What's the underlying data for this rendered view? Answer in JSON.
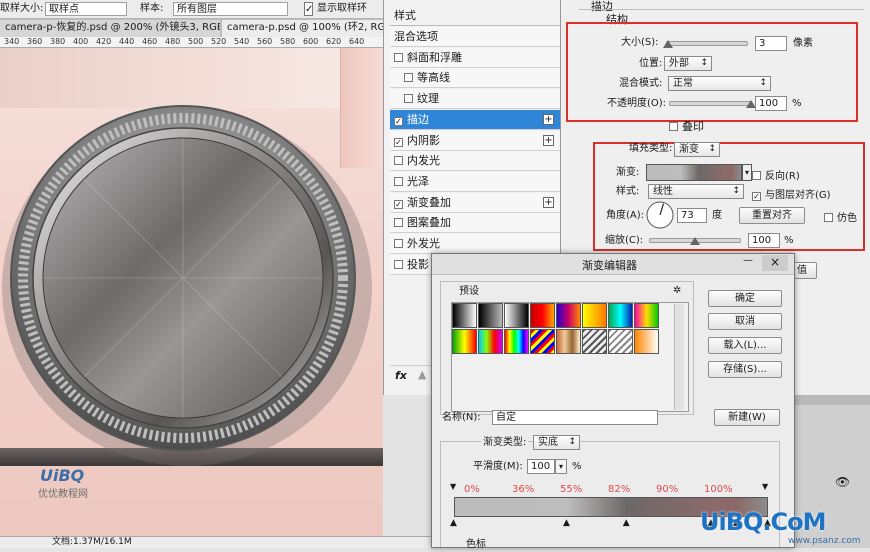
{
  "options_bar": {
    "sample_size_label": "取样大小:",
    "sample_size_value": "取样点",
    "sample_label": "样本:",
    "sample_value": "所有图层",
    "show_ring_label": "显示取样环"
  },
  "doc_tabs": [
    {
      "label": "camera-p-恢复的.psd @ 200% (外镜头3, RGB/8) *",
      "close": "×"
    },
    {
      "label": "camera-p.psd @ 100% (环2, RGB/8)",
      "close": "×"
    }
  ],
  "ruler_ticks": [
    "340",
    "360",
    "380",
    "400",
    "420",
    "440",
    "460",
    "480",
    "500",
    "520",
    "540",
    "560",
    "580",
    "600",
    "620",
    "640"
  ],
  "watermark_left": {
    "line1": "UiBQ",
    "line2": "优优教程网"
  },
  "status_bar": {
    "doc_info": "文档:1.37M/16.1M"
  },
  "styles_panel": {
    "header": "样式",
    "items": [
      {
        "label": "混合选项",
        "checkbox": false,
        "checked": false,
        "plus": false,
        "active": false,
        "indent": false
      },
      {
        "label": "斜面和浮雕",
        "checkbox": true,
        "checked": false,
        "plus": false,
        "active": false,
        "indent": false
      },
      {
        "label": "等高线",
        "checkbox": true,
        "checked": false,
        "plus": false,
        "active": false,
        "indent": true
      },
      {
        "label": "纹理",
        "checkbox": true,
        "checked": false,
        "plus": false,
        "active": false,
        "indent": true
      },
      {
        "label": "描边",
        "checkbox": true,
        "checked": true,
        "plus": true,
        "active": true,
        "indent": false
      },
      {
        "label": "内阴影",
        "checkbox": true,
        "checked": true,
        "plus": true,
        "active": false,
        "indent": false
      },
      {
        "label": "内发光",
        "checkbox": true,
        "checked": false,
        "plus": false,
        "active": false,
        "indent": false
      },
      {
        "label": "光泽",
        "checkbox": true,
        "checked": false,
        "plus": false,
        "active": false,
        "indent": false
      },
      {
        "label": "渐变叠加",
        "checkbox": true,
        "checked": true,
        "plus": true,
        "active": false,
        "indent": false
      },
      {
        "label": "图案叠加",
        "checkbox": true,
        "checked": false,
        "plus": false,
        "active": false,
        "indent": false
      },
      {
        "label": "外发光",
        "checkbox": true,
        "checked": false,
        "plus": false,
        "active": false,
        "indent": false
      },
      {
        "label": "投影",
        "checkbox": true,
        "checked": false,
        "plus": false,
        "active": false,
        "indent": false
      }
    ],
    "fx_label": "fx"
  },
  "stroke": {
    "title": "描边",
    "structure_title": "结构",
    "size_label": "大小(S):",
    "size_value": "3",
    "size_unit": "像素",
    "size_fraction": 0.02,
    "position_label": "位置:",
    "position_value": "外部",
    "blend_label": "混合模式:",
    "blend_value": "正常",
    "opacity_label": "不透明度(O):",
    "opacity_value": "100",
    "opacity_unit": "%",
    "opacity_fraction": 1.0,
    "overprint_label": "叠印",
    "fill_type_label": "填充类型:",
    "fill_type_value": "渐变",
    "gradient_label": "渐变:",
    "reverse_label": "反向(R)",
    "style_label": "样式:",
    "style_value": "线性",
    "align_label": "与图层对齐(G)",
    "align_checked": true,
    "angle_label": "角度(A):",
    "angle_value": "73",
    "angle_unit": "度",
    "reset_align_label": "重置对齐",
    "dither_label": "仿色",
    "scale_label": "缩放(C):",
    "scale_value": "100",
    "scale_unit": "%",
    "scale_fraction": 0.5,
    "partial_button": "值"
  },
  "gradient_editor": {
    "title": "渐变编辑器",
    "presets_label": "预设",
    "gear": "✲",
    "minimize": "—",
    "close": "×",
    "ok": "确定",
    "cancel": "取消",
    "load": "载入(L)...",
    "save": "存储(S)...",
    "name_label": "名称(N):",
    "name_value": "自定",
    "new_button": "新建(W)",
    "type_label": "渐变类型:",
    "type_value": "实底",
    "smooth_label": "平滑度(M):",
    "smooth_value": "100",
    "smooth_unit": "%",
    "stop_label": "色标",
    "stop_positions": [
      "0%",
      "36%",
      "55%",
      "82%",
      "90%",
      "100%"
    ],
    "stop_colors": [
      "bcbcbc",
      "bebdbd",
      "6d6868",
      "8a6a6a",
      "8d6868",
      "8c8c8c"
    ]
  },
  "colors": {
    "accent": "#2f86d9",
    "red_highlight": "#d9302a",
    "stop_text": "#e24b4b"
  },
  "watermark_right": {
    "logo": "UiBQ.CoM",
    "site": "www.psanz.com"
  }
}
